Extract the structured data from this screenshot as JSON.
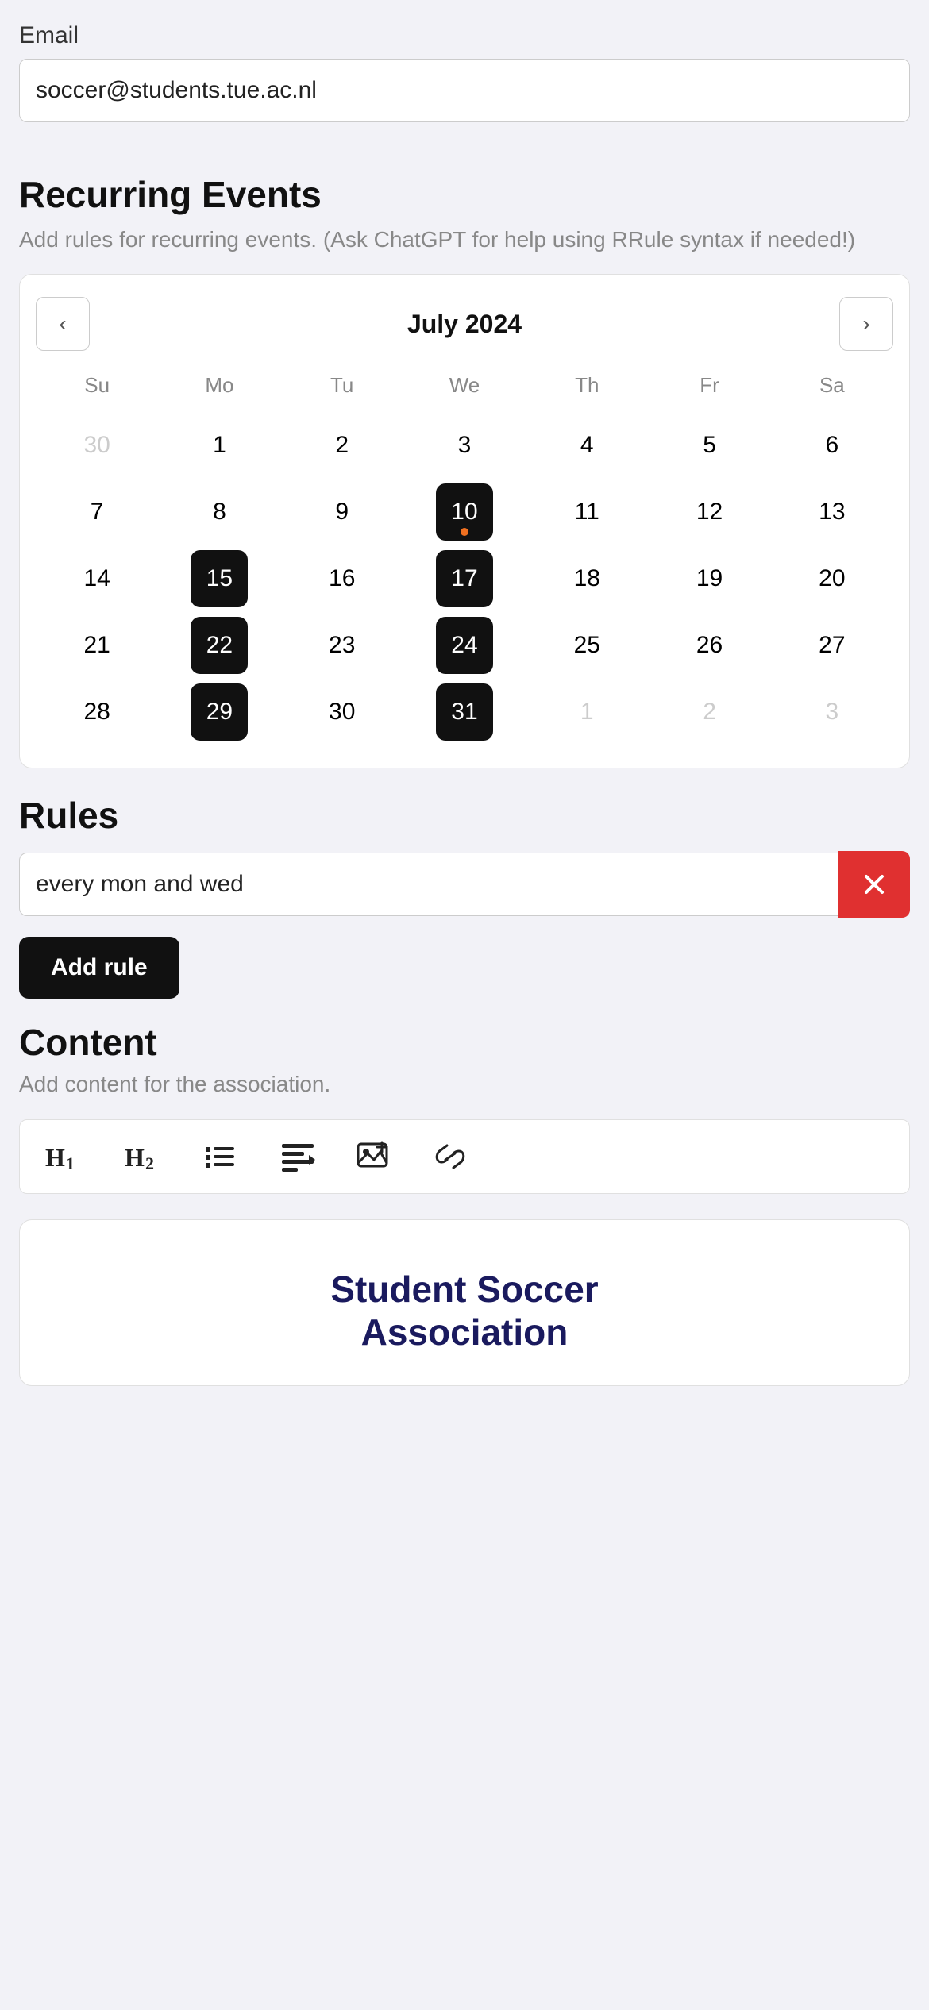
{
  "email": {
    "label": "Email",
    "value": "soccer@students.tue.ac.nl"
  },
  "recurring_events": {
    "title": "Recurring Events",
    "subtitle": "Add rules for recurring events. (Ask ChatGPT for help using RRule syntax if needed!)",
    "calendar": {
      "month_title": "July 2024",
      "prev_btn": "‹",
      "next_btn": "›",
      "weekdays": [
        "Su",
        "Mo",
        "Tu",
        "We",
        "Th",
        "Fr",
        "Sa"
      ],
      "weeks": [
        [
          {
            "day": "30",
            "other": true
          },
          {
            "day": "1"
          },
          {
            "day": "2"
          },
          {
            "day": "3"
          },
          {
            "day": "4"
          },
          {
            "day": "5"
          },
          {
            "day": "6"
          }
        ],
        [
          {
            "day": "7"
          },
          {
            "day": "8"
          },
          {
            "day": "9"
          },
          {
            "day": "10",
            "selected": true,
            "today_dot": true
          },
          {
            "day": "11"
          },
          {
            "day": "12"
          },
          {
            "day": "13"
          }
        ],
        [
          {
            "day": "14"
          },
          {
            "day": "15",
            "selected": true
          },
          {
            "day": "16"
          },
          {
            "day": "17",
            "selected": true
          },
          {
            "day": "18"
          },
          {
            "day": "19"
          },
          {
            "day": "20"
          }
        ],
        [
          {
            "day": "21"
          },
          {
            "day": "22",
            "selected": true
          },
          {
            "day": "23"
          },
          {
            "day": "24",
            "selected": true
          },
          {
            "day": "25"
          },
          {
            "day": "26"
          },
          {
            "day": "27"
          }
        ],
        [
          {
            "day": "28"
          },
          {
            "day": "29",
            "selected": true
          },
          {
            "day": "30"
          },
          {
            "day": "31",
            "selected": true
          },
          {
            "day": "1",
            "other": true
          },
          {
            "day": "2",
            "other": true
          },
          {
            "day": "3",
            "other": true
          }
        ]
      ]
    }
  },
  "rules": {
    "title": "Rules",
    "rule_value": "every mon and wed",
    "delete_btn_label": "×",
    "add_rule_label": "Add rule"
  },
  "content": {
    "title": "Content",
    "subtitle": "Add content for the association.",
    "toolbar_items": [
      {
        "label": "H₁",
        "name": "h1-btn"
      },
      {
        "label": "H₂",
        "name": "h2-btn"
      },
      {
        "label": "≡>",
        "name": "list-btn"
      },
      {
        "label": "⊡",
        "name": "align-btn"
      },
      {
        "label": "⊞+",
        "name": "image-btn"
      },
      {
        "label": "⚭",
        "name": "link-btn"
      }
    ]
  },
  "preview": {
    "title": "Student Soccer",
    "title2": "Association"
  }
}
